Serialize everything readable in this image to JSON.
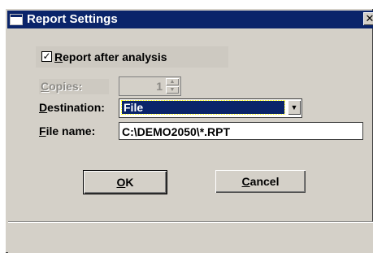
{
  "window": {
    "title": "Report Settings",
    "close_glyph": "✕"
  },
  "report_after_analysis": {
    "checked": true,
    "check_glyph": "✓",
    "label_accel": "R",
    "label_rest": "eport after analysis"
  },
  "copies": {
    "label_accel": "C",
    "label_rest": "opies:",
    "value": "1",
    "disabled": true
  },
  "destination": {
    "label_accel": "D",
    "label_rest": "estination:",
    "selected": "File"
  },
  "file_name": {
    "label_accel": "F",
    "label_rest": "ile name:",
    "value": "C:\\DEMO2050\\*.RPT"
  },
  "buttons": {
    "ok_accel": "O",
    "ok_rest": "K",
    "cancel_accel": "C",
    "cancel_rest": "ancel"
  },
  "icons": {
    "window": "window-icon",
    "close": "close-icon",
    "spin_up": "chevron-up-icon",
    "spin_down": "chevron-down-icon",
    "dropdown": "chevron-down-icon"
  },
  "colors": {
    "dialog_face": "#d4d0c8",
    "titlebar": "#0a246a",
    "selection": "#0a246a",
    "disabled_text": "#8c8a85"
  }
}
